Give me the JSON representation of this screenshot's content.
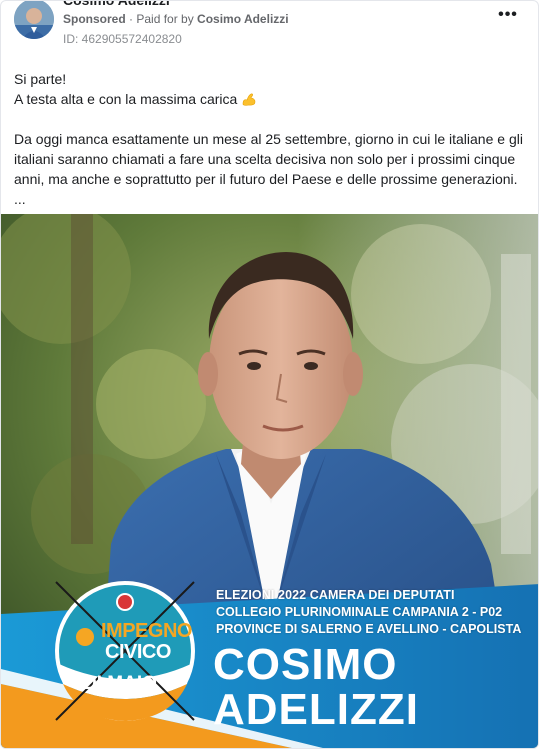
{
  "post": {
    "page_name": "Cosimo Adelizzi",
    "sponsored_label": "Sponsored",
    "separator": " · ",
    "paid_for_prefix": "Paid for by ",
    "paid_for_name": "Cosimo Adelizzi",
    "ad_id": "ID: 462905572402820",
    "more_icon": "more-icon",
    "text": {
      "line1": "Si parte!",
      "line2": "A testa alta e con la massima carica",
      "emoji": "flexed-biceps-icon",
      "paragraph": "Da oggi manca esattamente un mese al 25 settembre, giorno in cui le italiane e gli italiani saranno chiamati a fare una scelta decisiva non solo per i prossimi cinque anni, ma anche e soprattutto per il futuro del Paese e delle prossime generazioni.",
      "ellipsis": "..."
    }
  },
  "image": {
    "caption_line1": "ELEZIONI 2022 CAMERA DEI DEPUTATI",
    "caption_line2": "COLLEGIO PLURINOMINALE CAMPANIA 2 - P02",
    "caption_line3": "PROVINCE DI SALERNO E AVELLINO - CAPOLISTA",
    "candidate_first": "COSIMO",
    "candidate_last": "ADELIZZI",
    "logo": {
      "line1": "IMPEGNO",
      "line2": "CIVICO",
      "line3": "DI MAIO"
    }
  },
  "colors": {
    "banner_blue": "#1a8fd0",
    "banner_orange": "#f39a1e",
    "logo_teal": "#1f9bb8",
    "logo_orange": "#f5a623",
    "suit_blue": "#2f5d9c"
  }
}
